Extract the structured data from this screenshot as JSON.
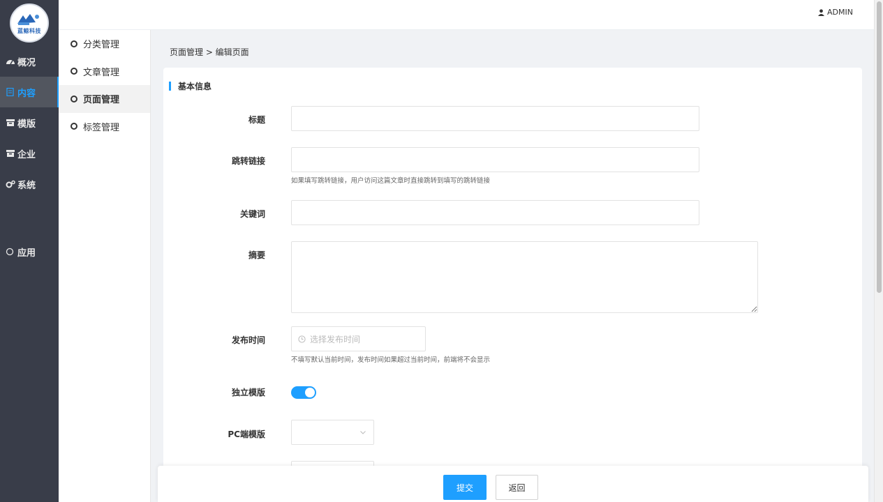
{
  "brand": {
    "logo_text": "蓝鲸科技"
  },
  "sidebar": {
    "items": [
      {
        "label": "概况",
        "icon": "dashboard-icon"
      },
      {
        "label": "内容",
        "icon": "document-icon",
        "active": true
      },
      {
        "label": "模版",
        "icon": "folder-icon"
      },
      {
        "label": "企业",
        "icon": "folder-icon"
      },
      {
        "label": "系统",
        "icon": "gears-icon"
      },
      {
        "label": "应用",
        "icon": "circle-icon"
      }
    ]
  },
  "subnav": {
    "items": [
      {
        "label": "分类管理"
      },
      {
        "label": "文章管理"
      },
      {
        "label": "页面管理",
        "active": true
      },
      {
        "label": "标签管理"
      }
    ]
  },
  "topbar": {
    "user": "ADMIN"
  },
  "breadcrumb": "页面管理 > 编辑页面",
  "form": {
    "section_title": "基本信息",
    "title_label": "标题",
    "title_value": "",
    "link_label": "跳转链接",
    "link_value": "",
    "link_tip": "如果填写跳转链接，用户访问这篇文章时直接跳转到填写的跳转链接",
    "keywords_label": "关键词",
    "keywords_value": "",
    "summary_label": "摘要",
    "summary_value": "",
    "publish_label": "发布时间",
    "publish_placeholder": "选择发布时间",
    "publish_tip": "不填写默认当前时间，发布时间如果超过当前时间，前端将不会显示",
    "template_switch_label": "独立模版",
    "template_switch_on": true,
    "pc_template_label": "PC端模版",
    "pc_template_value": ""
  },
  "actions": {
    "submit": "提交",
    "back": "返回"
  },
  "colors": {
    "accent": "#1e9fff",
    "sidebar_bg": "#393d49"
  }
}
